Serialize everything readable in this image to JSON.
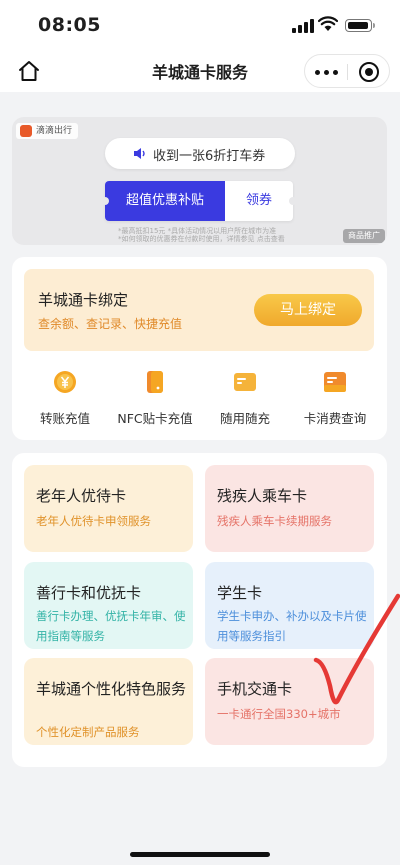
{
  "status_bar": {
    "time": "08:05"
  },
  "nav": {
    "title": "羊城通卡服务"
  },
  "ad": {
    "logo_text": "滴滴出行",
    "coupon_text": "收到一张6折打车券",
    "subsidy_label": "超值优惠补贴",
    "claim_label": "领券",
    "disclaimer_line1": "*最高抵扣15元 *具体活动情况以用户所在城市为准",
    "disclaimer_line2": "*如何领取的优惠券在付款时使用，详情参见 点击查看",
    "badge": "商品推广"
  },
  "bind": {
    "title": "羊城通卡绑定",
    "subtitle": "查余额、查记录、快捷充值",
    "button": "马上绑定"
  },
  "functions": [
    {
      "label": "转账充值",
      "icon": "yen-coin-icon"
    },
    {
      "label": "NFC贴卡充值",
      "icon": "nfc-card-icon"
    },
    {
      "label": "随用随充",
      "icon": "wallet-icon"
    },
    {
      "label": "卡消费查询",
      "icon": "card-query-icon"
    }
  ],
  "services": [
    {
      "title": "老年人优待卡",
      "desc": "老年人优待卡申领服务"
    },
    {
      "title": "残疾人乘车卡",
      "desc": "残疾人乘车卡续期服务"
    },
    {
      "title": "善行卡和优抚卡",
      "desc": "善行卡办理、优抚卡年审、使用指南等服务"
    },
    {
      "title": "学生卡",
      "desc": "学生卡申办、补办以及卡片使用等服务指引"
    },
    {
      "title": "羊城通个性化特色服务",
      "desc": "个性化定制产品服务"
    },
    {
      "title": "手机交通卡",
      "desc": "一卡通行全国330+城市"
    }
  ],
  "colors": {
    "accent_blue": "#3a3ae0",
    "bind_bg": "#fdedd3",
    "bind_button": "#f0a92c",
    "icon_orange": "#f5a623",
    "annotation_red": "#e53935"
  }
}
